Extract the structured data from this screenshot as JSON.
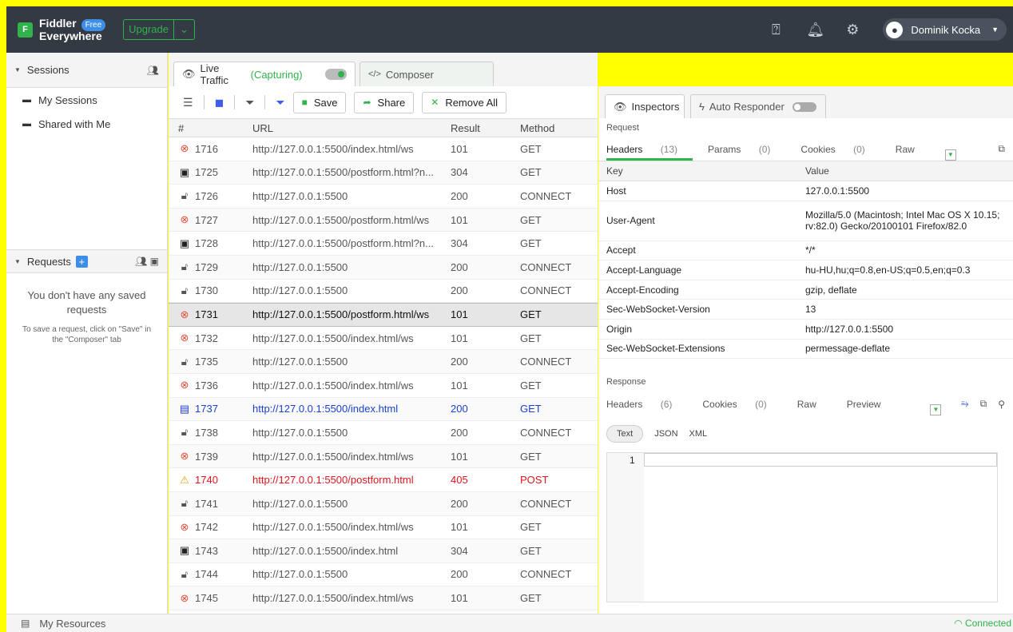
{
  "app": {
    "logo_letter": "F",
    "name_line1": "Fiddler",
    "name_line2": "Everywhere",
    "free_badge": "Free",
    "upgrade_label": "Upgrade",
    "user_name": "Dominik Kocka"
  },
  "colors": {
    "accent": "#2fb34a",
    "topbar": "#333a44",
    "highlight": "#ffff00"
  },
  "sidebar": {
    "sessions_label": "Sessions",
    "items": [
      {
        "label": "My Sessions",
        "icon": "folder-icon"
      },
      {
        "label": "Shared with Me",
        "icon": "shared-folder-icon"
      }
    ],
    "requests_label": "Requests",
    "empty_title": "You don't have any saved requests",
    "empty_hint": "To save a request, click on \"Save\" in the \"Composer\" tab"
  },
  "traffic": {
    "live_tab": "Live Traffic",
    "capturing": "(Capturing)",
    "composer_tab": "Composer",
    "save_label": "Save",
    "share_label": "Share",
    "remove_all_label": "Remove All",
    "columns": [
      "#",
      "URL",
      "Result",
      "Method"
    ],
    "rows": [
      {
        "id": "1716",
        "url": "http://127.0.0.1:5500/index.html/ws",
        "result": "101",
        "method": "GET",
        "icon": "websocket-icon",
        "style": ""
      },
      {
        "id": "1725",
        "url": "http://127.0.0.1:5500/postform.html?n...",
        "result": "304",
        "method": "GET",
        "icon": "cache-icon",
        "style": ""
      },
      {
        "id": "1726",
        "url": "http://127.0.0.1:5500",
        "result": "200",
        "method": "CONNECT",
        "icon": "lock-icon",
        "style": ""
      },
      {
        "id": "1727",
        "url": "http://127.0.0.1:5500/postform.html/ws",
        "result": "101",
        "method": "GET",
        "icon": "websocket-icon",
        "style": ""
      },
      {
        "id": "1728",
        "url": "http://127.0.0.1:5500/postform.html?n...",
        "result": "304",
        "method": "GET",
        "icon": "cache-icon",
        "style": ""
      },
      {
        "id": "1729",
        "url": "http://127.0.0.1:5500",
        "result": "200",
        "method": "CONNECT",
        "icon": "lock-icon",
        "style": ""
      },
      {
        "id": "1730",
        "url": "http://127.0.0.1:5500",
        "result": "200",
        "method": "CONNECT",
        "icon": "lock-icon",
        "style": ""
      },
      {
        "id": "1731",
        "url": "http://127.0.0.1:5500/postform.html/ws",
        "result": "101",
        "method": "GET",
        "icon": "websocket-icon",
        "style": "sel"
      },
      {
        "id": "1732",
        "url": "http://127.0.0.1:5500/index.html/ws",
        "result": "101",
        "method": "GET",
        "icon": "websocket-icon",
        "style": ""
      },
      {
        "id": "1735",
        "url": "http://127.0.0.1:5500",
        "result": "200",
        "method": "CONNECT",
        "icon": "lock-icon",
        "style": ""
      },
      {
        "id": "1736",
        "url": "http://127.0.0.1:5500/index.html/ws",
        "result": "101",
        "method": "GET",
        "icon": "websocket-icon",
        "style": ""
      },
      {
        "id": "1737",
        "url": "http://127.0.0.1:5500/index.html",
        "result": "200",
        "method": "GET",
        "icon": "html-icon",
        "style": "blue"
      },
      {
        "id": "1738",
        "url": "http://127.0.0.1:5500",
        "result": "200",
        "method": "CONNECT",
        "icon": "lock-icon",
        "style": ""
      },
      {
        "id": "1739",
        "url": "http://127.0.0.1:5500/index.html/ws",
        "result": "101",
        "method": "GET",
        "icon": "websocket-icon",
        "style": ""
      },
      {
        "id": "1740",
        "url": "http://127.0.0.1:5500/postform.html",
        "result": "405",
        "method": "POST",
        "icon": "warning-icon",
        "style": "red"
      },
      {
        "id": "1741",
        "url": "http://127.0.0.1:5500",
        "result": "200",
        "method": "CONNECT",
        "icon": "lock-icon",
        "style": ""
      },
      {
        "id": "1742",
        "url": "http://127.0.0.1:5500/index.html/ws",
        "result": "101",
        "method": "GET",
        "icon": "websocket-icon",
        "style": ""
      },
      {
        "id": "1743",
        "url": "http://127.0.0.1:5500/index.html",
        "result": "304",
        "method": "GET",
        "icon": "cache-icon",
        "style": ""
      },
      {
        "id": "1744",
        "url": "http://127.0.0.1:5500",
        "result": "200",
        "method": "CONNECT",
        "icon": "lock-icon",
        "style": ""
      },
      {
        "id": "1745",
        "url": "http://127.0.0.1:5500/index.html/ws",
        "result": "101",
        "method": "GET",
        "icon": "websocket-icon",
        "style": ""
      }
    ]
  },
  "inspectors": {
    "inspectors_tab": "Inspectors",
    "auto_responder_tab": "Auto Responder",
    "request_label": "Request",
    "req_tabs": [
      {
        "label": "Headers",
        "count": "(13)"
      },
      {
        "label": "Params",
        "count": "(0)"
      },
      {
        "label": "Cookies",
        "count": "(0)"
      },
      {
        "label": "Raw",
        "count": ""
      }
    ],
    "kv_key": "Key",
    "kv_value": "Value",
    "headers": [
      {
        "key": "Host",
        "value": "127.0.0.1:5500"
      },
      {
        "key": "User-Agent",
        "value": "Mozilla/5.0 (Macintosh; Intel Mac OS X 10.15; rv:82.0) Gecko/20100101 Firefox/82.0"
      },
      {
        "key": "Accept",
        "value": "*/*"
      },
      {
        "key": "Accept-Language",
        "value": "hu-HU,hu;q=0.8,en-US;q=0.5,en;q=0.3"
      },
      {
        "key": "Accept-Encoding",
        "value": "gzip, deflate"
      },
      {
        "key": "Sec-WebSocket-Version",
        "value": "13"
      },
      {
        "key": "Origin",
        "value": "http://127.0.0.1:5500"
      },
      {
        "key": "Sec-WebSocket-Extensions",
        "value": "permessage-deflate"
      }
    ],
    "response_label": "Response",
    "resp_tabs": [
      {
        "label": "Headers",
        "count": "(6)"
      },
      {
        "label": "Cookies",
        "count": "(0)"
      },
      {
        "label": "Raw",
        "count": ""
      },
      {
        "label": "Preview",
        "count": ""
      }
    ],
    "formats": [
      "Text",
      "JSON",
      "XML"
    ],
    "line_number": "1"
  },
  "footer": {
    "resources_label": "My Resources",
    "status": "Connected"
  }
}
